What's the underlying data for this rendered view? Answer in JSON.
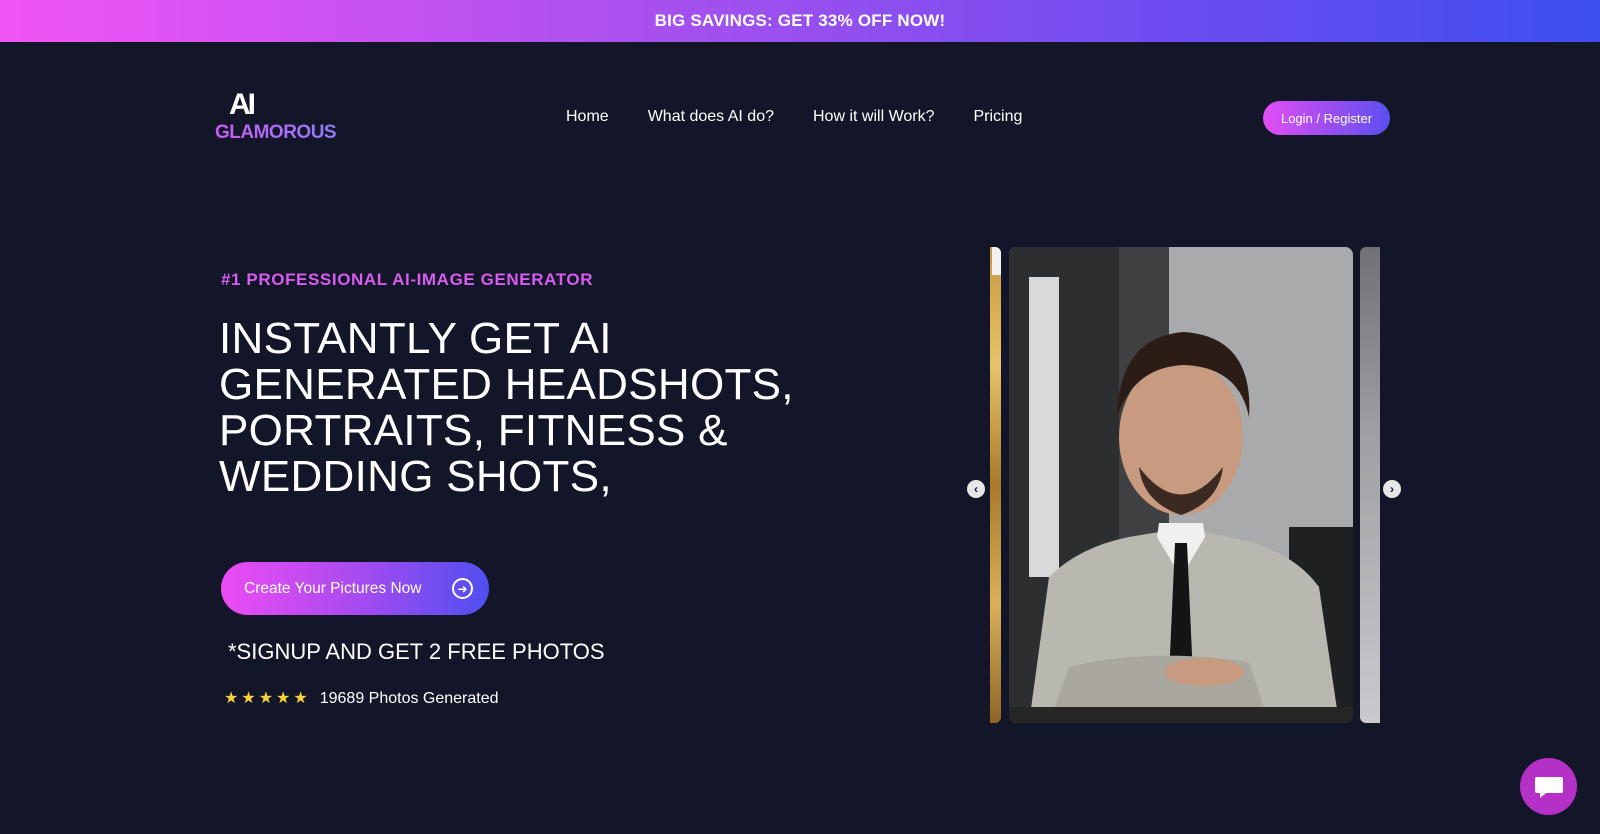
{
  "promo": {
    "text": "BIG SAVINGS: GET 33% OFF NOW!"
  },
  "header": {
    "logo_mark": "AI",
    "logo_word": "GLAMOROUS",
    "nav": [
      {
        "label": "Home"
      },
      {
        "label": "What does AI do?"
      },
      {
        "label": "How it will Work?"
      },
      {
        "label": "Pricing"
      }
    ],
    "login_label": "Login / Register"
  },
  "hero": {
    "eyebrow": "#1 PROFESSIONAL AI-IMAGE GENERATOR",
    "headline": "INSTANTLY GET AI GENERATED HEADSHOTS, PORTRAITS, FITNESS & WEDDING SHOTS,",
    "cta_label": "Create Your Pictures Now",
    "signup_note": "*SIGNUP AND GET 2 FREE PHOTOS",
    "rating_stars": 5,
    "photos_count": "19689 Photos Generated"
  },
  "carousel": {
    "prev_icon": "chevron-left-icon",
    "next_icon": "chevron-right-icon"
  },
  "colors": {
    "background": "#131628",
    "accent_pink": "#ec4cf2",
    "accent_blue": "#4e4ff0",
    "eyebrow": "#d85cf0",
    "star": "#f7d23a",
    "chat": "#b530c6"
  },
  "icons": {
    "chat": "chat-bubble-icon",
    "cta": "arrow-circle-right-icon",
    "star": "star-icon"
  }
}
